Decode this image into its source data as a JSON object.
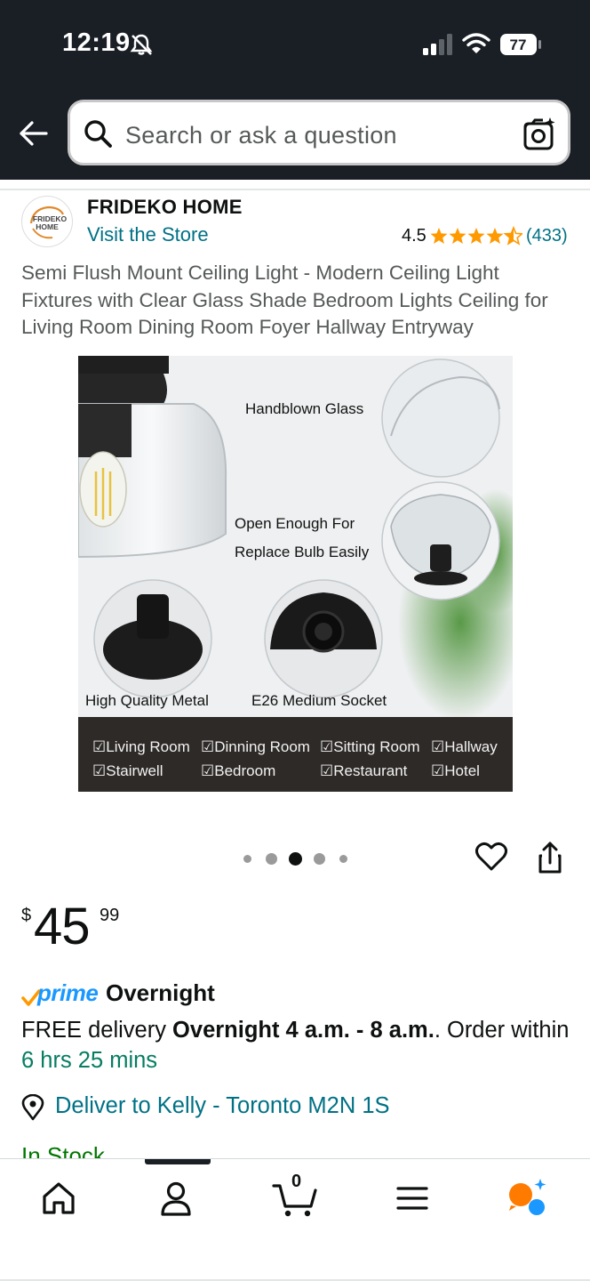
{
  "status_bar": {
    "time": "12:19",
    "battery": "77"
  },
  "search": {
    "placeholder": "Search or ask a question"
  },
  "store": {
    "logo_text_1": "FRIDEKO",
    "logo_text_2": "HOME",
    "name": "FRIDEKO HOME",
    "visit_label": "Visit the Store",
    "rating": "4.5",
    "rating_count": "(433)"
  },
  "product": {
    "title": "Semi Flush Mount Ceiling Light - Modern Ceiling Light Fixtures with Clear Glass Shade Bedroom Lights Ceiling for Living Room Dining Room Foyer Hallway Entryway",
    "image_labels": {
      "handblown": "Handblown Glass",
      "open_1": "Open Enough For",
      "open_2": "Replace Bulb Easily",
      "metal": "High Quality Metal",
      "socket": "E26 Medium Socket"
    },
    "features": [
      "Living Room",
      "Dinning Room",
      "Sitting Room",
      "Hallway",
      "Stairwell",
      "Bedroom",
      "Restaurant",
      "Hotel"
    ],
    "image_count": 5,
    "active_image": 3
  },
  "price": {
    "symbol": "$",
    "whole": "45",
    "fraction": "99"
  },
  "prime": {
    "brand": "prime",
    "label": "Overnight"
  },
  "delivery": {
    "prefix": "FREE delivery ",
    "window": "Overnight 4 a.m. - 8 a.m.",
    "mid": ". Order within ",
    "countdown": "6 hrs 25 mins"
  },
  "deliver_to": "Deliver to Kelly - Toronto M2N 1S",
  "stock": "In Stock",
  "cart": {
    "count": "0"
  },
  "colors": {
    "header": "#1a1f26",
    "link": "#007185",
    "prime": "#1a98ff",
    "star": "#ff9900",
    "green": "#067d62"
  }
}
